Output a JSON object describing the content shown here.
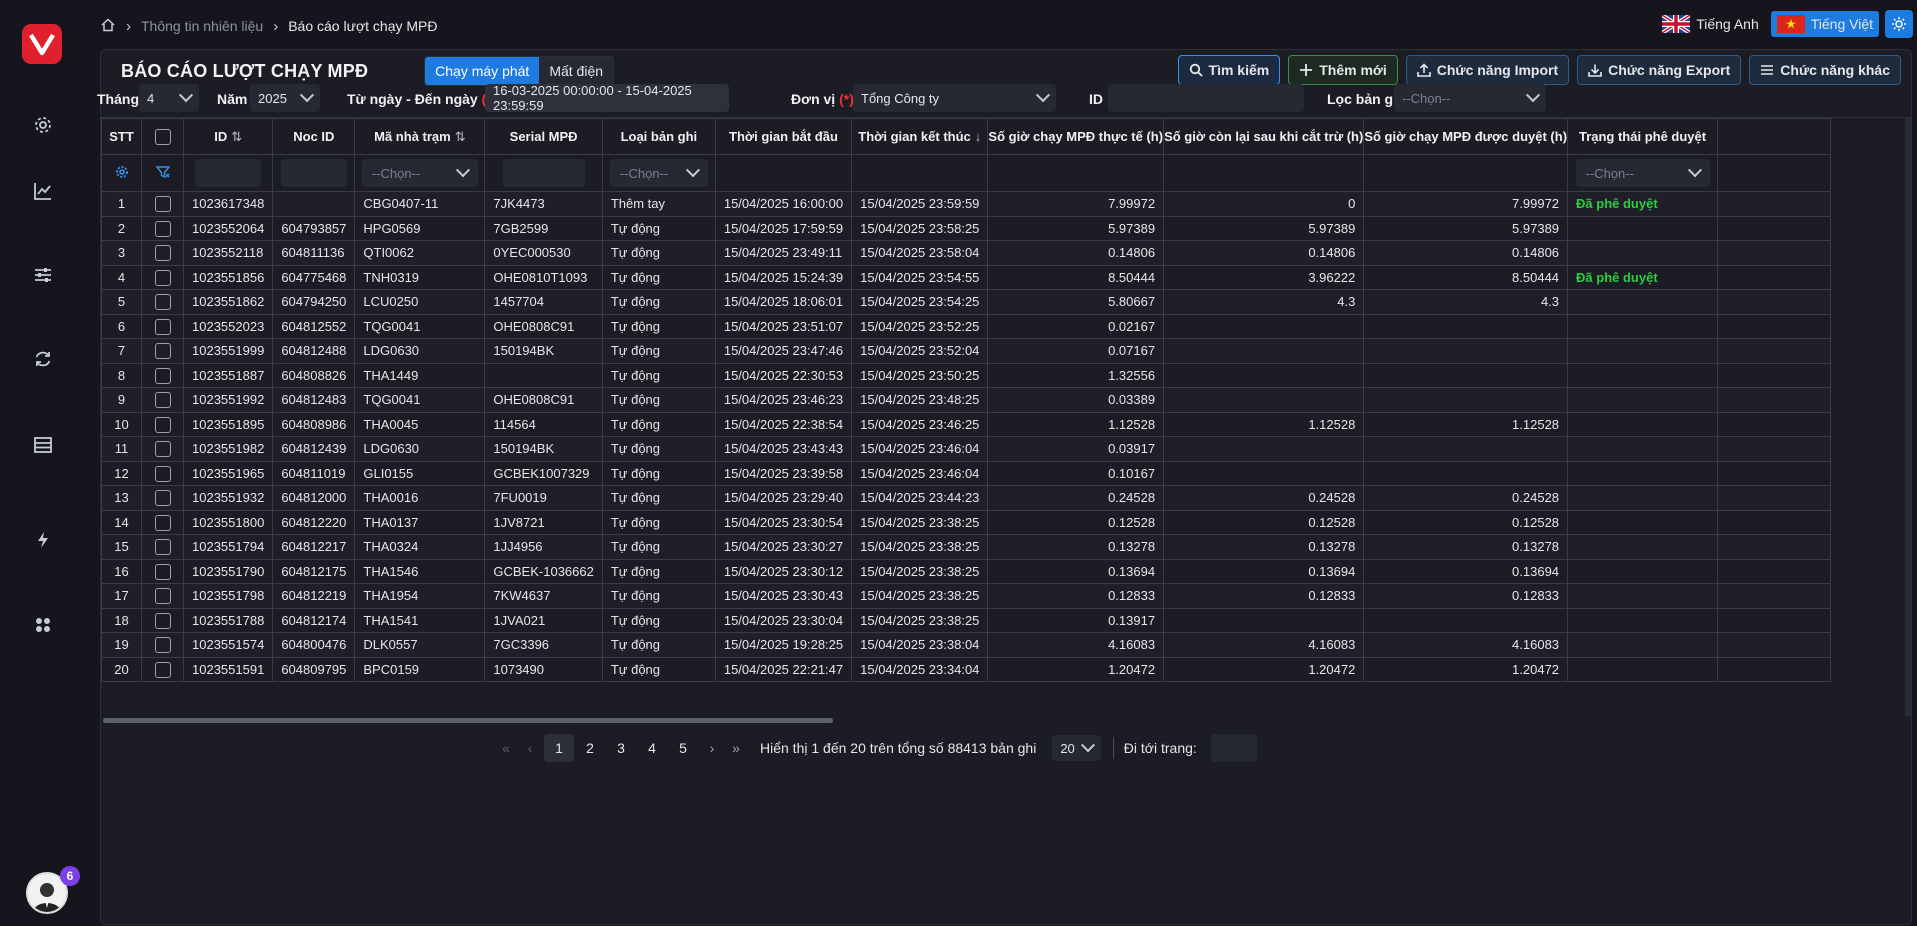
{
  "app": {
    "logo_letter": "V",
    "notification_count": "6"
  },
  "breadcrumb": {
    "parent": "Thông tin nhiên liệu",
    "current": "Báo cáo lượt chạy MPĐ"
  },
  "lang": {
    "english": "Tiếng Anh",
    "vietnamese": "Tiếng Việt"
  },
  "page": {
    "title": "BÁO CÁO LƯỢT CHẠY MPĐ",
    "seg_running": "Chạy máy phát",
    "seg_outage": "Mất điện"
  },
  "actions": {
    "search": "Tìm kiếm",
    "add": "Thêm mới",
    "import": "Chức năng Import",
    "export": "Chức năng Export",
    "other": "Chức năng khác"
  },
  "filters": {
    "month_label": "Tháng",
    "month_value": "4",
    "year_label": "Năm",
    "year_value": "2025",
    "range_label": "Từ ngày - Đến ngày",
    "range_req": "(*)",
    "range_value": "16-03-2025 00:00:00 - 15-04-2025 23:59:59",
    "unit_label": "Đơn vị",
    "unit_req": "(*)",
    "unit_value": "Tổng Công ty",
    "id_label": "ID",
    "record_label": "Lọc bản ghi",
    "record_placeholder": "--Chọn--"
  },
  "table": {
    "headers": {
      "stt": "STT",
      "id": "ID",
      "noc_id": "Noc ID",
      "station": "Mã nhà trạm",
      "serial": "Serial MPĐ",
      "type": "Loại bản ghi",
      "start": "Thời gian bắt đầu",
      "end": "Thời gian kết thúc",
      "actual": "Số giờ chạy MPĐ thực tế (h)",
      "remaining": "Số giờ còn lại sau khi cắt trừ (h)",
      "approved_hours": "Số giờ chạy MPĐ được duyệt (h)",
      "status": "Trạng thái phê duyệt"
    },
    "filter_placeholder": "--Chọn--",
    "rows": [
      {
        "stt": "1",
        "id": "1023617348",
        "noc": "",
        "station": "CBG0407-11",
        "serial": "7JK4473",
        "type": "Thêm tay",
        "start": "15/04/2025 16:00:00",
        "end": "15/04/2025 23:59:59",
        "actual": "7.99972",
        "remaining": "0",
        "approved": "7.99972",
        "status": "Đã phê duyệt"
      },
      {
        "stt": "2",
        "id": "1023552064",
        "noc": "604793857",
        "station": "HPG0569",
        "serial": "7GB2599",
        "type": "Tự động",
        "start": "15/04/2025 17:59:59",
        "end": "15/04/2025 23:58:25",
        "actual": "5.97389",
        "remaining": "5.97389",
        "approved": "5.97389",
        "status": ""
      },
      {
        "stt": "3",
        "id": "1023552118",
        "noc": "604811136",
        "station": "QTI0062",
        "serial": "0YEC000530",
        "type": "Tự động",
        "start": "15/04/2025 23:49:11",
        "end": "15/04/2025 23:58:04",
        "actual": "0.14806",
        "remaining": "0.14806",
        "approved": "0.14806",
        "status": ""
      },
      {
        "stt": "4",
        "id": "1023551856",
        "noc": "604775468",
        "station": "TNH0319",
        "serial": "OHE0810T1093",
        "type": "Tự động",
        "start": "15/04/2025 15:24:39",
        "end": "15/04/2025 23:54:55",
        "actual": "8.50444",
        "remaining": "3.96222",
        "approved": "8.50444",
        "status": "Đã phê duyệt"
      },
      {
        "stt": "5",
        "id": "1023551862",
        "noc": "604794250",
        "station": "LCU0250",
        "serial": "1457704",
        "type": "Tự động",
        "start": "15/04/2025 18:06:01",
        "end": "15/04/2025 23:54:25",
        "actual": "5.80667",
        "remaining": "4.3",
        "approved": "4.3",
        "status": ""
      },
      {
        "stt": "6",
        "id": "1023552023",
        "noc": "604812552",
        "station": "TQG0041",
        "serial": "OHE0808C91",
        "type": "Tự động",
        "start": "15/04/2025 23:51:07",
        "end": "15/04/2025 23:52:25",
        "actual": "0.02167",
        "remaining": "",
        "approved": "",
        "status": ""
      },
      {
        "stt": "7",
        "id": "1023551999",
        "noc": "604812488",
        "station": "LDG0630",
        "serial": "150194BK",
        "type": "Tự động",
        "start": "15/04/2025 23:47:46",
        "end": "15/04/2025 23:52:04",
        "actual": "0.07167",
        "remaining": "",
        "approved": "",
        "status": ""
      },
      {
        "stt": "8",
        "id": "1023551887",
        "noc": "604808826",
        "station": "THA1449",
        "serial": "",
        "type": "Tự động",
        "start": "15/04/2025 22:30:53",
        "end": "15/04/2025 23:50:25",
        "actual": "1.32556",
        "remaining": "",
        "approved": "",
        "status": ""
      },
      {
        "stt": "9",
        "id": "1023551992",
        "noc": "604812483",
        "station": "TQG0041",
        "serial": "OHE0808C91",
        "type": "Tự động",
        "start": "15/04/2025 23:46:23",
        "end": "15/04/2025 23:48:25",
        "actual": "0.03389",
        "remaining": "",
        "approved": "",
        "status": ""
      },
      {
        "stt": "10",
        "id": "1023551895",
        "noc": "604808986",
        "station": "THA0045",
        "serial": "114564",
        "type": "Tự động",
        "start": "15/04/2025 22:38:54",
        "end": "15/04/2025 23:46:25",
        "actual": "1.12528",
        "remaining": "1.12528",
        "approved": "1.12528",
        "status": ""
      },
      {
        "stt": "11",
        "id": "1023551982",
        "noc": "604812439",
        "station": "LDG0630",
        "serial": "150194BK",
        "type": "Tự động",
        "start": "15/04/2025 23:43:43",
        "end": "15/04/2025 23:46:04",
        "actual": "0.03917",
        "remaining": "",
        "approved": "",
        "status": ""
      },
      {
        "stt": "12",
        "id": "1023551965",
        "noc": "604811019",
        "station": "GLI0155",
        "serial": "GCBEK1007329",
        "type": "Tự động",
        "start": "15/04/2025 23:39:58",
        "end": "15/04/2025 23:46:04",
        "actual": "0.10167",
        "remaining": "",
        "approved": "",
        "status": ""
      },
      {
        "stt": "13",
        "id": "1023551932",
        "noc": "604812000",
        "station": "THA0016",
        "serial": "7FU0019",
        "type": "Tự động",
        "start": "15/04/2025 23:29:40",
        "end": "15/04/2025 23:44:23",
        "actual": "0.24528",
        "remaining": "0.24528",
        "approved": "0.24528",
        "status": ""
      },
      {
        "stt": "14",
        "id": "1023551800",
        "noc": "604812220",
        "station": "THA0137",
        "serial": "1JV8721",
        "type": "Tự động",
        "start": "15/04/2025 23:30:54",
        "end": "15/04/2025 23:38:25",
        "actual": "0.12528",
        "remaining": "0.12528",
        "approved": "0.12528",
        "status": ""
      },
      {
        "stt": "15",
        "id": "1023551794",
        "noc": "604812217",
        "station": "THA0324",
        "serial": "1JJ4956",
        "type": "Tự động",
        "start": "15/04/2025 23:30:27",
        "end": "15/04/2025 23:38:25",
        "actual": "0.13278",
        "remaining": "0.13278",
        "approved": "0.13278",
        "status": ""
      },
      {
        "stt": "16",
        "id": "1023551790",
        "noc": "604812175",
        "station": "THA1546",
        "serial": "GCBEK-1036662",
        "type": "Tự động",
        "start": "15/04/2025 23:30:12",
        "end": "15/04/2025 23:38:25",
        "actual": "0.13694",
        "remaining": "0.13694",
        "approved": "0.13694",
        "status": ""
      },
      {
        "stt": "17",
        "id": "1023551798",
        "noc": "604812219",
        "station": "THA1954",
        "serial": "7KW4637",
        "type": "Tự động",
        "start": "15/04/2025 23:30:43",
        "end": "15/04/2025 23:38:25",
        "actual": "0.12833",
        "remaining": "0.12833",
        "approved": "0.12833",
        "status": ""
      },
      {
        "stt": "18",
        "id": "1023551788",
        "noc": "604812174",
        "station": "THA1541",
        "serial": "1JVA021",
        "type": "Tự động",
        "start": "15/04/2025 23:30:04",
        "end": "15/04/2025 23:38:25",
        "actual": "0.13917",
        "remaining": "",
        "approved": "",
        "status": ""
      },
      {
        "stt": "19",
        "id": "1023551574",
        "noc": "604800476",
        "station": "DLK0557",
        "serial": "7GC3396",
        "type": "Tự động",
        "start": "15/04/2025 19:28:25",
        "end": "15/04/2025 23:38:04",
        "actual": "4.16083",
        "remaining": "4.16083",
        "approved": "4.16083",
        "status": ""
      },
      {
        "stt": "20",
        "id": "1023551591",
        "noc": "604809795",
        "station": "BPC0159",
        "serial": "1073490",
        "type": "Tự động",
        "start": "15/04/2025 22:21:47",
        "end": "15/04/2025 23:34:04",
        "actual": "1.20472",
        "remaining": "1.20472",
        "approved": "1.20472",
        "status": ""
      }
    ]
  },
  "pagination": {
    "pages": [
      "1",
      "2",
      "3",
      "4",
      "5"
    ],
    "current": "1",
    "info": "Hiển thị 1 đến 20 trên tổng số 88413 bản ghi",
    "page_size": "20",
    "goto_label": "Đi tới trang:"
  },
  "colors": {
    "accent": "#1e7be0",
    "approved": "#2ecc40",
    "brand": "#e0202e"
  }
}
